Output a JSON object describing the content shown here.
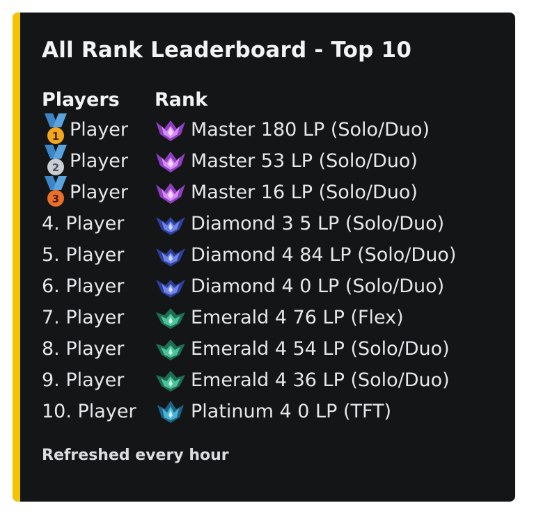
{
  "embed": {
    "title": "All Rank Leaderboard - Top 10",
    "accent_color": "#f5c400",
    "background_color": "#141517",
    "players_header": "Players",
    "rank_header": "Rank",
    "footer": "Refreshed every hour"
  },
  "players": [
    {
      "prefix_icon": "gold-medal-icon",
      "medal_number": "1",
      "name": "Player"
    },
    {
      "prefix_icon": "silver-medal-icon",
      "medal_number": "2",
      "name": "Player"
    },
    {
      "prefix_icon": "bronze-medal-icon",
      "medal_number": "3",
      "name": "Player"
    },
    {
      "label": "4. Player"
    },
    {
      "label": "5. Player"
    },
    {
      "label": "6. Player"
    },
    {
      "label": "7. Player"
    },
    {
      "label": "8. Player"
    },
    {
      "label": "9. Player"
    },
    {
      "label": "10. Player"
    }
  ],
  "ranks": [
    {
      "icon": "master-rank-icon",
      "text": "Master 180 LP (Solo/Duo)"
    },
    {
      "icon": "master-rank-icon",
      "text": "Master 53 LP (Solo/Duo)"
    },
    {
      "icon": "master-rank-icon",
      "text": "Master 16 LP (Solo/Duo)"
    },
    {
      "icon": "diamond-rank-icon",
      "text": "Diamond 3 5 LP (Solo/Duo)"
    },
    {
      "icon": "diamond-rank-icon",
      "text": "Diamond 4 84 LP (Solo/Duo)"
    },
    {
      "icon": "diamond-rank-icon",
      "text": "Diamond 4 0 LP (Solo/Duo)"
    },
    {
      "icon": "emerald-rank-icon",
      "text": "Emerald 4 76 LP (Flex)"
    },
    {
      "icon": "emerald-rank-icon",
      "text": "Emerald 4 54 LP (Solo/Duo)"
    },
    {
      "icon": "emerald-rank-icon",
      "text": "Emerald 4 36 LP (Solo/Duo)"
    },
    {
      "icon": "platinum-rank-icon",
      "text": "Platinum 4 0 LP (TFT)"
    }
  ],
  "colors": {
    "master": "#b44fe0",
    "diamond": "#4a63d8",
    "emerald": "#2fa07c",
    "platinum": "#2a8fb4",
    "gold_medal": "#f2a51f",
    "silver_medal": "#c9ced4",
    "bronze_medal": "#e8702a",
    "ribbon": "#3d86c6"
  }
}
